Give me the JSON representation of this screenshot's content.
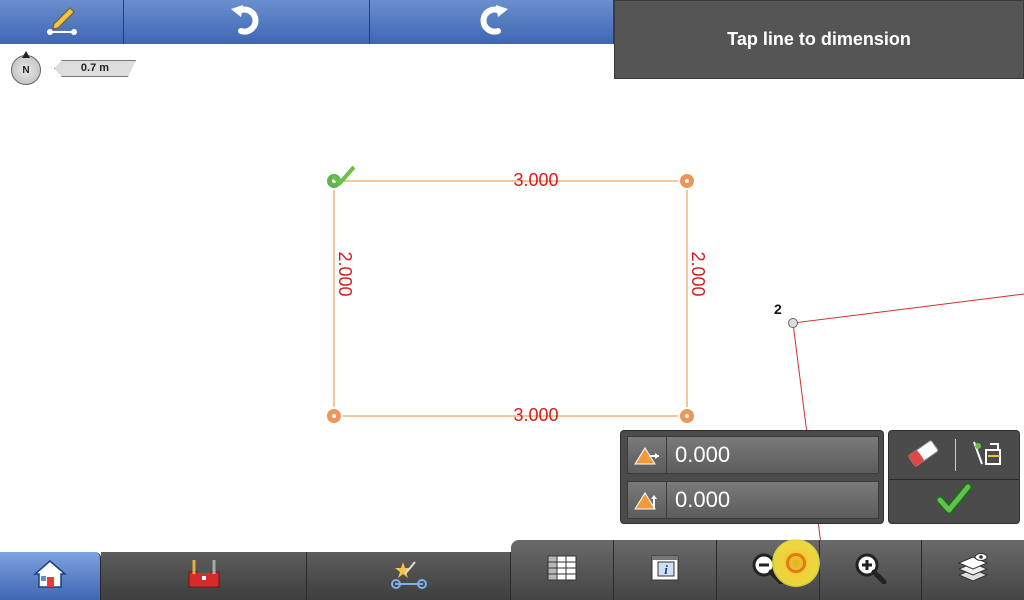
{
  "toolbar": {
    "items": [
      {
        "name": "edit-linework-button",
        "icon": "pencil-line-icon"
      },
      {
        "name": "undo-button",
        "icon": "undo-icon"
      },
      {
        "name": "redo-button",
        "icon": "redo-icon"
      }
    ]
  },
  "prompt": {
    "text": "Tap line to dimension"
  },
  "compass": {
    "label": "N"
  },
  "scale": {
    "label": "0.7 m"
  },
  "map": {
    "dimensions": {
      "top": "3.000",
      "bottom": "3.000",
      "left": "2.000",
      "right": "2.000"
    },
    "point_label": "2",
    "colors": {
      "outline": "#f2b27a",
      "dimension_text": "#d71b1b",
      "survey_line": "#d23030"
    }
  },
  "coords": {
    "north_value": "0.000",
    "east_value": "0.000"
  },
  "actions": {
    "erase_icon": "eraser-icon",
    "snap_icon": "snap-tool-icon",
    "accept_icon": "checkmark-icon"
  },
  "bottom_tabs": [
    {
      "name": "home",
      "icon": "home-icon",
      "active": true
    },
    {
      "name": "toolbox",
      "icon": "toolbox-icon"
    },
    {
      "name": "cogo",
      "icon": "cogo-icon"
    }
  ],
  "tool_tabs": [
    {
      "name": "table-view",
      "icon": "grid-icon"
    },
    {
      "name": "info",
      "icon": "info-icon"
    },
    {
      "name": "zoom-out",
      "icon": "zoom-out-icon"
    },
    {
      "name": "zoom-in",
      "icon": "zoom-in-icon"
    },
    {
      "name": "layers",
      "icon": "layers-icon"
    }
  ]
}
